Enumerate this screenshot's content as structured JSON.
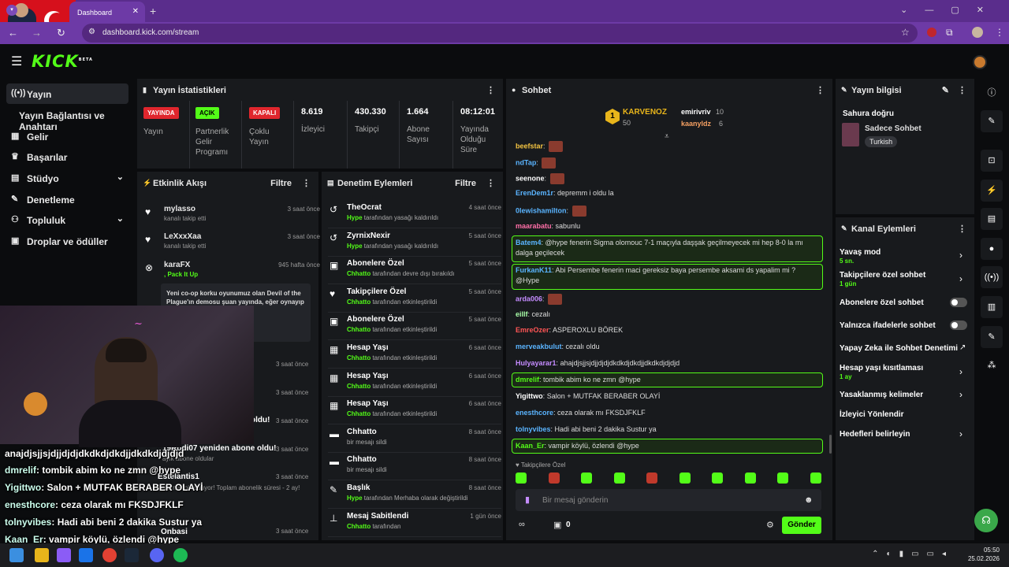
{
  "browser": {
    "tab_title": "Dashboard",
    "url": "dashboard.kick.com/stream"
  },
  "brand": {
    "logo": "KICK",
    "beta": "BETA"
  },
  "sidebar": {
    "items": [
      {
        "label": "Yayın",
        "icon": "stream-icon"
      },
      {
        "label": "Yayın Bağlantısı ve Anahtarı",
        "icon": ""
      },
      {
        "label": "Gelir",
        "icon": "chart-icon"
      },
      {
        "label": "Başarılar",
        "icon": "trophy-icon"
      },
      {
        "label": "Stüdyo",
        "icon": "grid-icon"
      },
      {
        "label": "Denetleme",
        "icon": "wrench-icon"
      },
      {
        "label": "Topluluk",
        "icon": "people-icon"
      },
      {
        "label": "Droplar ve ödüller",
        "icon": "gift-icon"
      }
    ]
  },
  "stats": {
    "title": "Yayın İstatistikleri",
    "live_badge": "YAYINDA",
    "live_label": "Yayın",
    "partner_badge": "AÇIK",
    "partner_label": "Partnerlik Gelir Programı",
    "multi_badge": "KAPALI",
    "multi_label": "Çoklu Yayın",
    "viewers": "8.619",
    "viewers_label": "İzleyici",
    "followers": "430.330",
    "followers_label": "Takipçi",
    "subs": "1.664",
    "subs_label": "Abone Sayısı",
    "uptime": "08:12:01",
    "uptime_label": "Yayında Olduğu Süre"
  },
  "activity": {
    "title": "Etkinlik Akışı",
    "filter": "Filtre",
    "items": [
      {
        "name": "mylasso",
        "sub": "kanalı takip etti",
        "time": "3 saat önce"
      },
      {
        "name": "LeXxxXaa",
        "sub": "kanalı takip etti",
        "time": "3 saat önce"
      },
      {
        "name": "karaFX",
        "sub": ", Pack It Up",
        "time": "945 hafta önce"
      }
    ],
    "message": "Yeni co-op korku oyunumuz olan Devil of the Plague'ın demosu şuan yayında, eğer oynayıp ...tlu oluruz. İyi",
    "times_more": [
      "3 saat önce",
      "3 saat önce",
      "3 saat önce",
      "3 saat önce",
      "3 saat önce",
      "3 saat önce"
    ],
    "partial1": "oldu!",
    "partial2": "19Rodi07 yeniden abone oldu!",
    "partial2_sub": "ayık abone oldular",
    "partial3": "Estelantis1",
    "partial3_sub": "enilemesini kutluyor! Toplam abonelik süresi - 2 ay!",
    "partial4": "Onbasi"
  },
  "moderation": {
    "title": "Denetim Eylemleri",
    "filter": "Filtre",
    "items": [
      {
        "name": "TheOcrat",
        "actor": "Hype",
        "sub": "tarafından yasağı kaldırıldı",
        "time": "4 saat önce",
        "icon": "undo-icon"
      },
      {
        "name": "ZyrnixNexir",
        "actor": "Hype",
        "sub": "tarafından yasağı kaldırıldı",
        "time": "5 saat önce",
        "icon": "undo-icon"
      },
      {
        "name": "Abonelere Özel",
        "actor": "Chhatto",
        "sub": "tarafından devre dışı bırakıldı",
        "time": "5 saat önce",
        "icon": "gift-icon"
      },
      {
        "name": "Takipçilere Özel",
        "actor": "Chhatto",
        "sub": "tarafından etkinleştirildi",
        "time": "5 saat önce",
        "icon": "heart-icon"
      },
      {
        "name": "Abonelere Özel",
        "actor": "Chhatto",
        "sub": "tarafından etkinleştirildi",
        "time": "5 saat önce",
        "icon": "gift-icon"
      },
      {
        "name": "Hesap Yaşı",
        "actor": "Chhatto",
        "sub": "tarafından etkinleştirildi",
        "time": "6 saat önce",
        "icon": "calendar-icon"
      },
      {
        "name": "Hesap Yaşı",
        "actor": "Chhatto",
        "sub": "tarafından etkinleştirildi",
        "time": "6 saat önce",
        "icon": "calendar-icon"
      },
      {
        "name": "Hesap Yaşı",
        "actor": "Chhatto",
        "sub": "tarafından etkinleştirildi",
        "time": "6 saat önce",
        "icon": "calendar-icon"
      },
      {
        "name": "Chhatto",
        "actor": "",
        "sub": "bir mesajı sildi",
        "time": "8 saat önce",
        "icon": "trash-icon"
      },
      {
        "name": "Chhatto",
        "actor": "",
        "sub": "bir mesajı sildi",
        "time": "8 saat önce",
        "icon": "trash-icon"
      },
      {
        "name": "Başlık",
        "actor": "Hype",
        "sub": "tarafından Merhaba olarak değiştirildi",
        "time": "8 saat önce",
        "icon": "edit-icon"
      },
      {
        "name": "Mesaj Sabitlendi",
        "actor": "Chhatto",
        "sub": "tarafından",
        "time": "1 gün önce",
        "icon": "pin-icon"
      }
    ]
  },
  "chat": {
    "title": "Sohbet",
    "top1": {
      "name": "KARVENOZ",
      "score": "50"
    },
    "top2": {
      "name": "emirivriv",
      "score": "10"
    },
    "top3": {
      "name": "kaanyldz",
      "score": "6"
    },
    "lines": [
      {
        "user": "beefstar",
        "color": "#f5c542",
        "text": ""
      },
      {
        "user": "ndTap",
        "color": "#5ab4ff",
        "text": ""
      },
      {
        "user": "seenone",
        "color": "#ffffff",
        "text": ""
      },
      {
        "user": "ErenDem1r",
        "color": "#5ab4ff",
        "text": "depremm i oldu la"
      },
      {
        "user": "0lewishamilton",
        "color": "#5ab4ff",
        "text": ""
      },
      {
        "user": "maarabatu",
        "color": "#ff6fa8",
        "text": "sabunlu"
      },
      {
        "user": "Batem4",
        "color": "#5ab4ff",
        "text": "@hype fenerin Sigma olomouc 7-1 maçıyla daşşak geçilmeyecek mi hep 8-0 la mı dalga geçilecek"
      },
      {
        "user": "FurkanK11",
        "color": "#5ab4ff",
        "text": "Abi Persembe fenerin maci gereksiz baya persembe aksami ds yapalim mi ? @Hype"
      },
      {
        "user": "arda006",
        "color": "#c58cff",
        "text": ""
      },
      {
        "user": "eillf",
        "color": "#aaffaa",
        "text": "cezalı"
      },
      {
        "user": "EmreOzer",
        "color": "#ff5555",
        "text": "ASPEROXLU BÖREK"
      },
      {
        "user": "merveakbulut",
        "color": "#5ab4ff",
        "text": "cezalı oldu"
      },
      {
        "user": "Hulyayarar1",
        "color": "#c58cff",
        "text": "ahajdjsjjsjdjjdjdjdkdkdjdkdjjdkdkdjdjdjd"
      },
      {
        "user": "dmrelif",
        "color": "#53fc18",
        "text": "tombik abim ko ne zmn @hype"
      },
      {
        "user": "Yigittwo",
        "color": "#ffffff",
        "text": "Salon + MUTFAK BERABER OLAYİ"
      },
      {
        "user": "enesthcore",
        "color": "#5ab4ff",
        "text": "ceza olarak mı FKSDJFKLF"
      },
      {
        "user": "tolnyvibes",
        "color": "#5ab4ff",
        "text": "Hadi abi beni 2 dakika Sustur ya"
      },
      {
        "user": "Kaan_Er",
        "color": "#53fc18",
        "text": "vampir köylü, özlendi @hype"
      }
    ],
    "mode": "Takipçilere Özel",
    "placeholder": "Bir mesaj gönderin",
    "count": "0",
    "send": "Gönder"
  },
  "streaminfo": {
    "title": "Yayın bilgisi",
    "stream_title": "Sahura doğru",
    "category": "Sadece Sohbet",
    "tag": "Turkish"
  },
  "channel": {
    "title": "Kanal Eylemleri",
    "slow": "Yavaş mod",
    "slow_sub": "5 sn.",
    "followers": "Takipçilere özel sohbet",
    "followers_sub": "1 gün",
    "subs_only": "Abonelere özel sohbet",
    "emotes_only": "Yalnızca ifadelerle sohbet",
    "ai": "Yapay Zeka ile Sohbet Denetimi",
    "age": "Hesap yaşı kısıtlaması",
    "age_sub": "1 ay",
    "banned": "Yasaklanmış kelimeler",
    "redirect": "İzleyici Yönlendir",
    "goals": "Hedefleri belirleyin"
  },
  "overlay": {
    "lines": [
      {
        "user": "",
        "text": "anajdjsjjsjdjjdjdjdkdkdjdkdjjdkdkdjdjdjd"
      },
      {
        "user": "dmrelif",
        "text": ": tombik abim ko ne zmn @hype"
      },
      {
        "user": "Yigittwo",
        "text": ": Salon + MUTFAK BERABER OLAYİ"
      },
      {
        "user": "enesthcore",
        "text": ": ceza olarak mı FKSDJFKLF"
      },
      {
        "user": "tolnyvibes",
        "text": ": Hadi abi beni 2 dakika Sustur ya"
      },
      {
        "user": "Kaan_Er",
        "text": ": vampir köylü, özlendi @hype"
      }
    ]
  },
  "taskbar": {
    "time": "05:50",
    "date": "25.02.2026"
  }
}
